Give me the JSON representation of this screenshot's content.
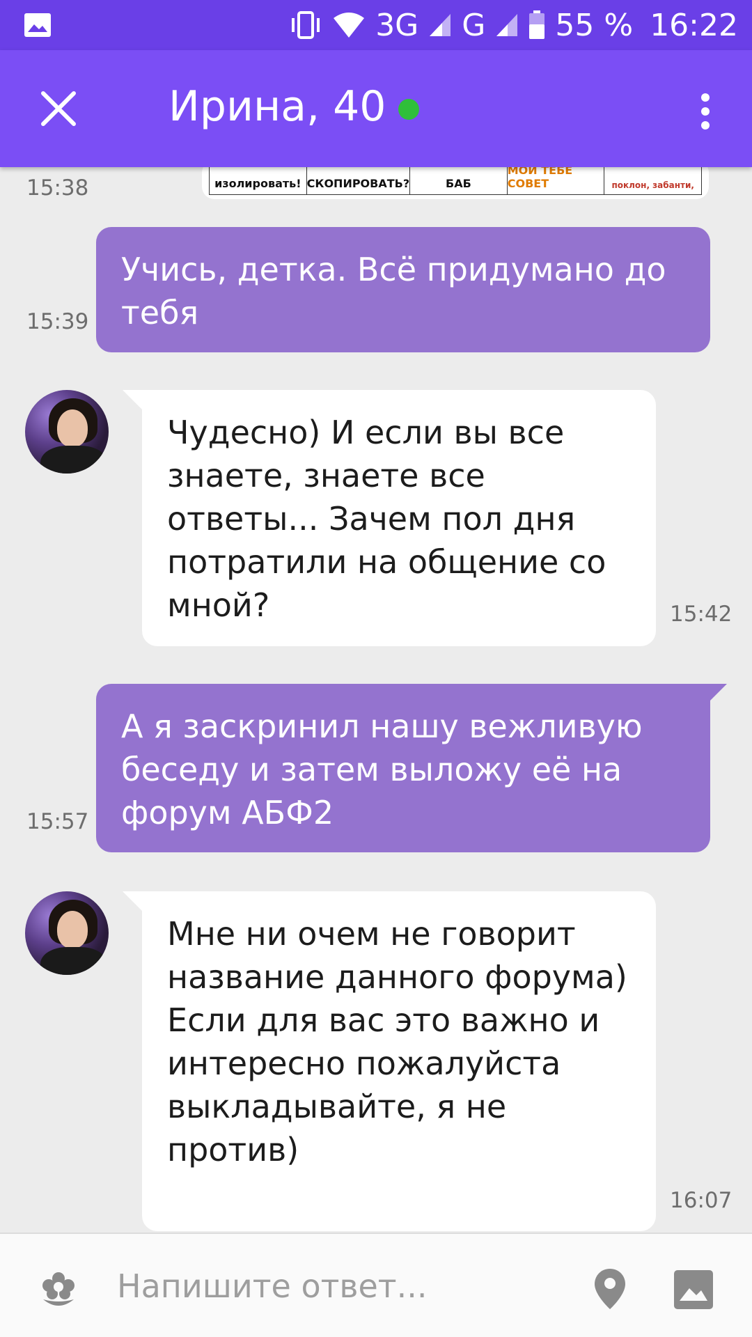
{
  "status_bar": {
    "network_1": "3G",
    "network_2": "G",
    "battery": "55 %",
    "time": "16:22",
    "icons": [
      "image-icon",
      "vibrate-icon",
      "wifi-icon",
      "signal-icon",
      "battery-icon"
    ]
  },
  "header": {
    "title": "Ирина, 40",
    "online": true,
    "colors": {
      "status_bar": "#6a3fe7",
      "app_bar": "#7b4ef5",
      "online_dot": "#2fbf3a"
    }
  },
  "chat": {
    "image_preview": {
      "time": "15:38",
      "cells": [
        "изолировать!",
        "СКОПИРОВАТЬ?",
        "БАБ",
        "МОЙ ТЕБЕ СОВЕТ",
        "поклон, забанти,"
      ]
    },
    "messages": [
      {
        "direction": "out",
        "time": "15:39",
        "text": "Учись, детка. Всё придумано до тебя"
      },
      {
        "direction": "in",
        "time": "15:42",
        "text": "Чудесно) И если вы все знаете, знаете все ответы... Зачем пол дня потратили на общение со мной?"
      },
      {
        "direction": "out",
        "time": "15:57",
        "text": "А я заскринил нашу вежливую беседу и затем выложу её на форум АБФ2"
      },
      {
        "direction": "in",
        "time": "16:07",
        "text": "Мне ни очем не говорит название данного форума) Если для вас это важно и интересно пожалуйста выкладывайте, я не против)"
      }
    ],
    "colors": {
      "outgoing_bubble": "#9473cf",
      "incoming_bubble": "#ffffff"
    }
  },
  "composer": {
    "placeholder": "Напишите ответ..."
  }
}
